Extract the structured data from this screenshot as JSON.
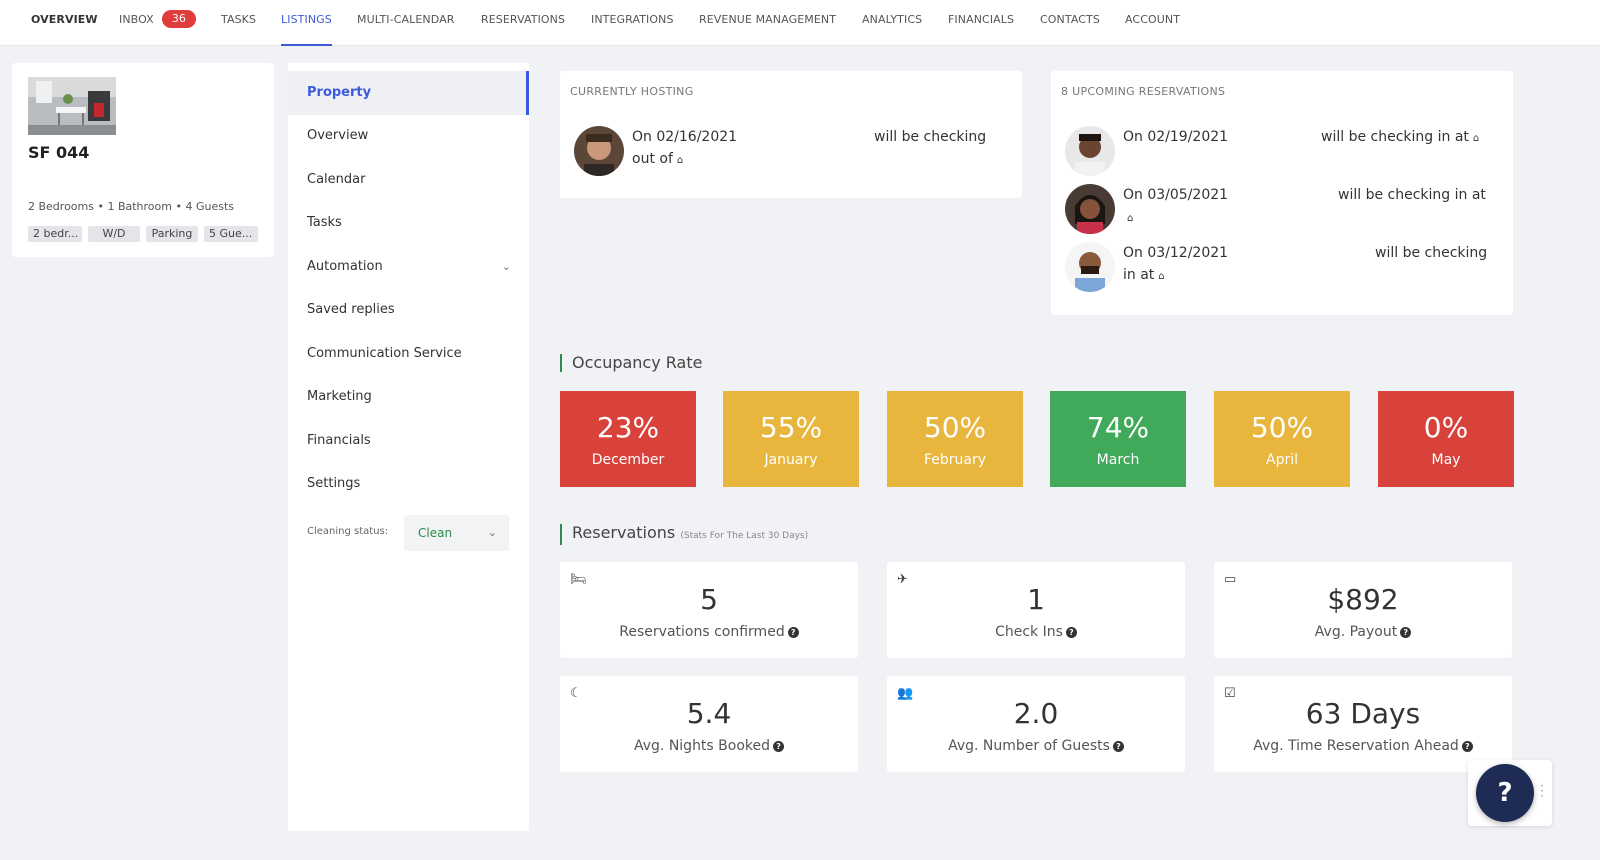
{
  "nav": {
    "items": [
      {
        "label": "OVERVIEW"
      },
      {
        "label": "INBOX",
        "badge": "36"
      },
      {
        "label": "TASKS"
      },
      {
        "label": "LISTINGS"
      },
      {
        "label": "MULTI-CALENDAR"
      },
      {
        "label": "RESERVATIONS"
      },
      {
        "label": "INTEGRATIONS"
      },
      {
        "label": "REVENUE MANAGEMENT"
      },
      {
        "label": "ANALYTICS"
      },
      {
        "label": "FINANCIALS"
      },
      {
        "label": "CONTACTS"
      },
      {
        "label": "ACCOUNT"
      }
    ]
  },
  "property": {
    "name": "SF 044",
    "meta": "2 Bedrooms • 1 Bathroom • 4 Guests",
    "tags": [
      "2 bedr...",
      "W/D",
      "Parking",
      "5 Gue..."
    ]
  },
  "menu": {
    "items": [
      {
        "label": "Property"
      },
      {
        "label": "Overview"
      },
      {
        "label": "Calendar"
      },
      {
        "label": "Tasks"
      },
      {
        "label": "Automation",
        "chevron": "⌄"
      },
      {
        "label": "Saved replies"
      },
      {
        "label": "Communication Service"
      },
      {
        "label": "Marketing"
      },
      {
        "label": "Financials"
      },
      {
        "label": "Settings"
      }
    ],
    "cleaning_label": "Cleaning status:",
    "cleaning_value": "Clean"
  },
  "hosting": {
    "title": "CURRENTLY HOSTING",
    "date": "On 02/16/2021",
    "action_line1": "will be checking",
    "action_line2": "out of"
  },
  "upcoming": {
    "title": "8 UPCOMING RESERVATIONS",
    "items": [
      {
        "date": "On 02/19/2021",
        "text": "will be checking in at"
      },
      {
        "date": "On 03/05/2021",
        "text": "will be checking in at"
      },
      {
        "date": "On 03/12/2021",
        "text": "will be checking",
        "text2": "in at"
      }
    ]
  },
  "occupancy": {
    "heading": "Occupancy Rate",
    "months": [
      {
        "pct": "23%",
        "month": "December",
        "color": "#d9423b"
      },
      {
        "pct": "55%",
        "month": "January",
        "color": "#e8b63c"
      },
      {
        "pct": "50%",
        "month": "February",
        "color": "#e8b63c"
      },
      {
        "pct": "74%",
        "month": "March",
        "color": "#40a95a"
      },
      {
        "pct": "50%",
        "month": "April",
        "color": "#e8b63c"
      },
      {
        "pct": "0%",
        "month": "May",
        "color": "#d9423b"
      }
    ]
  },
  "reservations": {
    "heading": "Reservations",
    "subheading": "(Stats For The Last 30 Days)",
    "stats": [
      {
        "icon": "bed-icon",
        "value": "5",
        "label": "Reservations confirmed"
      },
      {
        "icon": "plane-icon",
        "value": "1",
        "label": "Check Ins"
      },
      {
        "icon": "money-icon",
        "value": "$892",
        "label": "Avg. Payout"
      },
      {
        "icon": "moon-icon",
        "value": "5.4",
        "label": "Avg. Nights Booked"
      },
      {
        "icon": "users-icon",
        "value": "2.0",
        "label": "Avg. Number of Guests"
      },
      {
        "icon": "calendar-check-icon",
        "value": "63 Days",
        "label": "Avg. Time Reservation Ahead"
      }
    ]
  },
  "help": {
    "label": "?"
  }
}
